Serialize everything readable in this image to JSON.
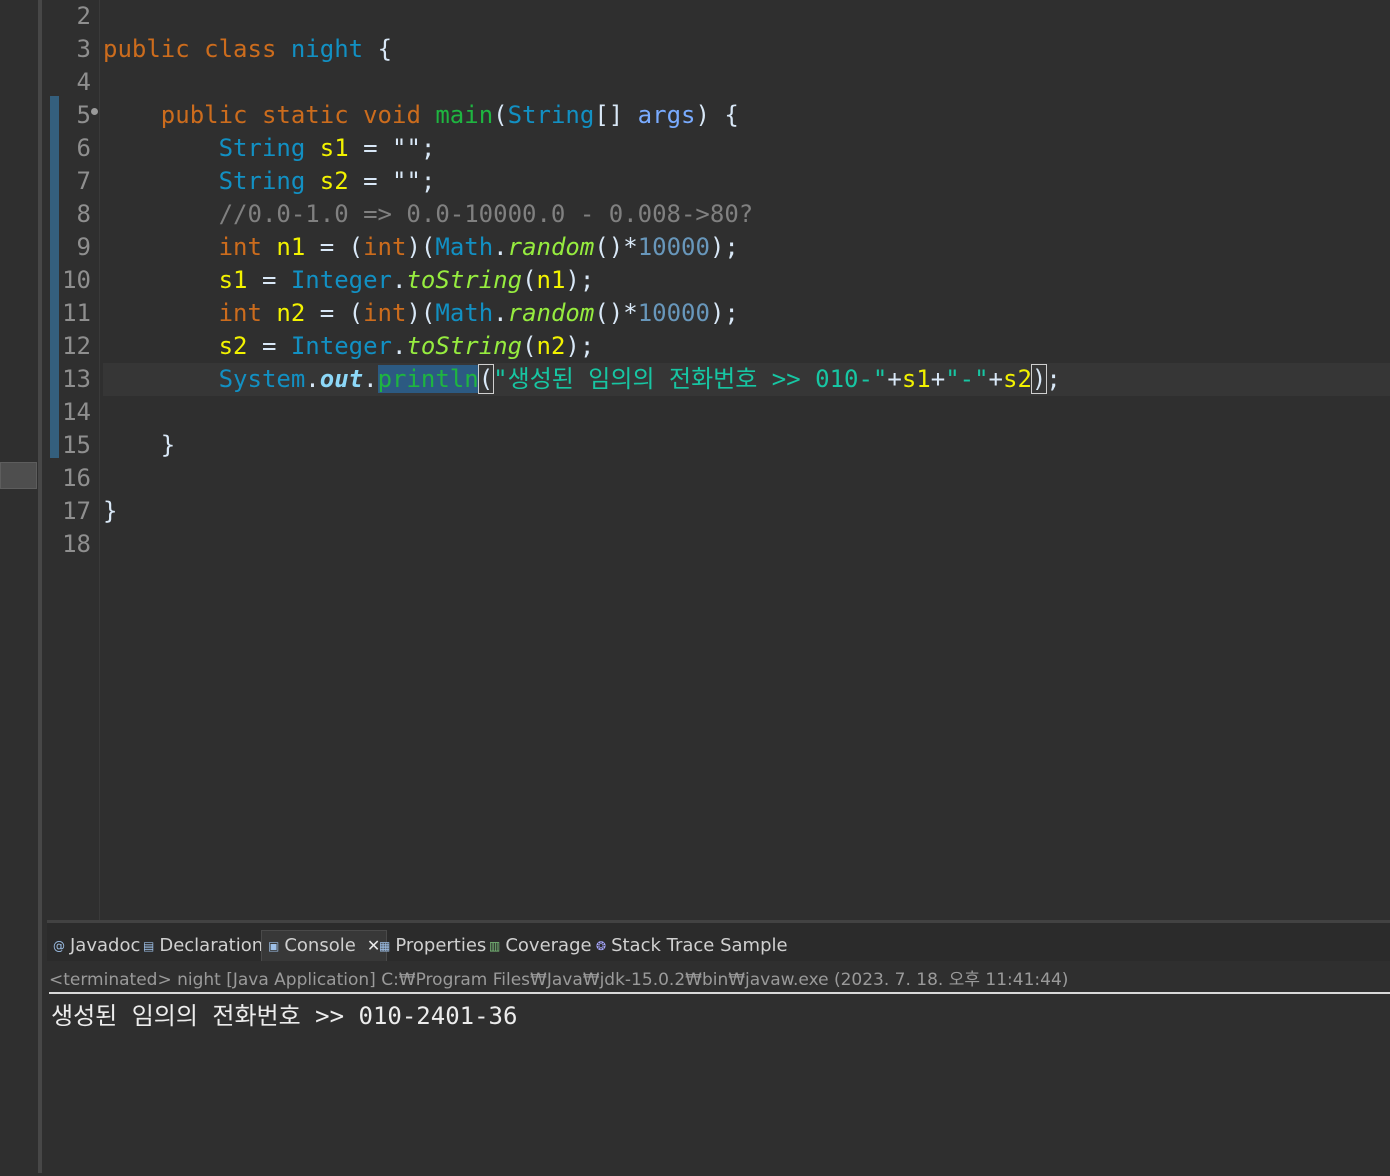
{
  "editor": {
    "line_numbers": [
      "2",
      "3",
      "4",
      "5",
      "6",
      "7",
      "8",
      "9",
      "10",
      "11",
      "12",
      "13",
      "14",
      "15",
      "16",
      "17",
      "18"
    ],
    "code": {
      "l3": {
        "kw1": "public",
        "kw2": "class",
        "name": "night",
        "brace": "{"
      },
      "l5": {
        "kw1": "public",
        "kw2": "static",
        "kw3": "void",
        "method": "main",
        "p1": "(",
        "type": "String",
        "arr": "[]",
        "param": "args",
        "p2": ")",
        "brace": "{"
      },
      "l6": {
        "type": "String",
        "var": "s1",
        "rest": " = \"\";"
      },
      "l7": {
        "type": "String",
        "var": "s2",
        "rest": " = \"\";"
      },
      "l8": {
        "comment": "//0.0-1.0 => 0.0-10000.0 - 0.008->80?"
      },
      "l9": {
        "kw": "int",
        "var": "n1",
        "eq": " = (",
        "kw2": "int",
        "p": ")(",
        "cls": "Math",
        "dot": ".",
        "meth": "random",
        "p2": "()*",
        "num": "10000",
        "end": ");"
      },
      "l10": {
        "var": "s1",
        "eq": " = ",
        "cls": "Integer",
        "dot": ".",
        "meth": "toString",
        "p": "(",
        "arg": "n1",
        "end": ");"
      },
      "l11": {
        "kw": "int",
        "var": "n2",
        "eq": " = (",
        "kw2": "int",
        "p": ")(",
        "cls": "Math",
        "dot": ".",
        "meth": "random",
        "p2": "()*",
        "num": "10000",
        "end": ");"
      },
      "l12": {
        "var": "s2",
        "eq": " = ",
        "cls": "Integer",
        "dot": ".",
        "meth": "toString",
        "p": "(",
        "arg": "n2",
        "end": ");"
      },
      "l13": {
        "cls": "System",
        "dot1": ".",
        "field": "out",
        "dot2": ".",
        "meth": "println",
        "p": "(",
        "str": "\"생성된 임의의 전화번호 >> 010-\"",
        "plus1": "+",
        "v1": "s1",
        "plus2": "+",
        "str2": "\"-\"",
        "plus3": "+",
        "v2": "s2",
        "close": ")",
        "end": ";"
      },
      "l15": {
        "brace": "}"
      },
      "l17": {
        "brace": "}"
      }
    }
  },
  "panel": {
    "tabs": [
      {
        "label": "Javadoc",
        "icon": "@"
      },
      {
        "label": "Declaration",
        "icon": "▤"
      },
      {
        "label": "Console",
        "icon": "▣",
        "close": "✕"
      },
      {
        "label": "Properties",
        "icon": "▦"
      },
      {
        "label": "Coverage",
        "icon": "▥"
      },
      {
        "label": "Stack Trace Sample",
        "icon": "❂"
      }
    ],
    "status": "<terminated> night [Java Application] C:₩Program Files₩Java₩jdk-15.0.2₩bin₩javaw.exe (2023. 7. 18. 오후 11:41:44)",
    "output": "생성된 임의의 전화번호 >> 010-2401-36"
  }
}
